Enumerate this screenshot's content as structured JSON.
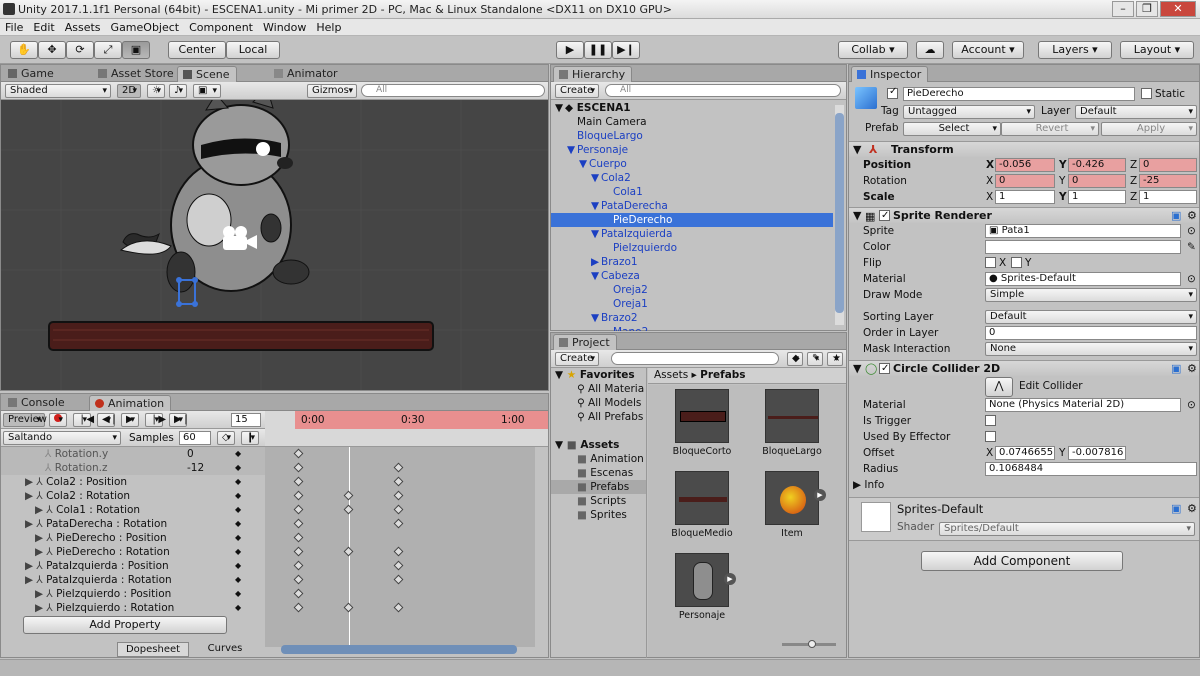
{
  "window": {
    "title": "Unity 2017.1.1f1 Personal (64bit) - ESCENA1.unity - Mi primer 2D - PC, Mac & Linux Standalone <DX11 on DX10 GPU>"
  },
  "menu": [
    "File",
    "Edit",
    "Assets",
    "GameObject",
    "Component",
    "Window",
    "Help"
  ],
  "toolbar": {
    "center": "Center",
    "local": "Local",
    "collab": "Collab",
    "account": "Account",
    "layers": "Layers",
    "layout": "Layout"
  },
  "scene_tabs": {
    "game": "Game",
    "asset_store": "Asset Store",
    "scene": "Scene",
    "animator": "Animator"
  },
  "scene_strip": {
    "shaded": "Shaded",
    "mode2d": "2D",
    "gizmos": "Gizmos",
    "search": "All"
  },
  "hierarchy": {
    "tab": "Hierarchy",
    "create": "Create",
    "search": "All",
    "items": [
      {
        "label": "ESCENA1",
        "indent": 0,
        "arrow": "▼",
        "root": true,
        "sel": false
      },
      {
        "label": "Main Camera",
        "indent": 1,
        "arrow": "",
        "root": false,
        "sel": false,
        "plain": true
      },
      {
        "label": "BloqueLargo",
        "indent": 1,
        "arrow": "",
        "root": false,
        "sel": false
      },
      {
        "label": "Personaje",
        "indent": 1,
        "arrow": "▼",
        "root": false,
        "sel": false
      },
      {
        "label": "Cuerpo",
        "indent": 2,
        "arrow": "▼",
        "root": false,
        "sel": false
      },
      {
        "label": "Cola2",
        "indent": 3,
        "arrow": "▼",
        "root": false,
        "sel": false
      },
      {
        "label": "Cola1",
        "indent": 4,
        "arrow": "",
        "root": false,
        "sel": false
      },
      {
        "label": "PataDerecha",
        "indent": 3,
        "arrow": "▼",
        "root": false,
        "sel": false
      },
      {
        "label": "PieDerecho",
        "indent": 4,
        "arrow": "",
        "root": false,
        "sel": true
      },
      {
        "label": "PataIzquierda",
        "indent": 3,
        "arrow": "▼",
        "root": false,
        "sel": false
      },
      {
        "label": "PieIzquierdo",
        "indent": 4,
        "arrow": "",
        "root": false,
        "sel": false
      },
      {
        "label": "Brazo1",
        "indent": 3,
        "arrow": "▶",
        "root": false,
        "sel": false
      },
      {
        "label": "Cabeza",
        "indent": 3,
        "arrow": "▼",
        "root": false,
        "sel": false
      },
      {
        "label": "Oreja2",
        "indent": 4,
        "arrow": "",
        "root": false,
        "sel": false
      },
      {
        "label": "Oreja1",
        "indent": 4,
        "arrow": "",
        "root": false,
        "sel": false
      },
      {
        "label": "Brazo2",
        "indent": 3,
        "arrow": "▼",
        "root": false,
        "sel": false
      },
      {
        "label": "Mano2",
        "indent": 4,
        "arrow": "",
        "root": false,
        "sel": false
      }
    ]
  },
  "project": {
    "tab": "Project",
    "create": "Create",
    "favorites": "Favorites",
    "fav_items": [
      "All Materia",
      "All Models",
      "All Prefabs"
    ],
    "assets": "Assets",
    "folders": [
      "Animation",
      "Escenas",
      "Prefabs",
      "Scripts",
      "Sprites"
    ],
    "breadcrumb": [
      "Assets",
      "Prefabs"
    ],
    "prefabs": [
      "BloqueCorto",
      "BloqueLargo",
      "BloqueMedio",
      "Item",
      "Personaje"
    ]
  },
  "inspector": {
    "tab": "Inspector",
    "name": "PieDerecho",
    "static": "Static",
    "tag_label": "Tag",
    "tag": "Untagged",
    "layer_label": "Layer",
    "layer": "Default",
    "prefab_label": "Prefab",
    "select": "Select",
    "revert": "Revert",
    "apply": "Apply",
    "transform": {
      "title": "Transform",
      "position": "Position",
      "rotation": "Rotation",
      "scale": "Scale",
      "pos": [
        "-0.056",
        "-0.426",
        "0"
      ],
      "rot": [
        "0",
        "0",
        "-25"
      ],
      "scl": [
        "1",
        "1",
        "1"
      ]
    },
    "sprite_renderer": {
      "title": "Sprite Renderer",
      "sprite_label": "Sprite",
      "sprite": "Pata1",
      "color_label": "Color",
      "flip_label": "Flip",
      "material_label": "Material",
      "material": "Sprites-Default",
      "draw_label": "Draw Mode",
      "draw": "Simple",
      "sorting_label": "Sorting Layer",
      "sorting": "Default",
      "order_label": "Order in Layer",
      "order": "0",
      "mask_label": "Mask Interaction",
      "mask": "None"
    },
    "collider": {
      "title": "Circle Collider 2D",
      "edit": "Edit Collider",
      "material_label": "Material",
      "material": "None (Physics Material 2D)",
      "trigger_label": "Is Trigger",
      "effector_label": "Used By Effector",
      "offset_label": "Offset",
      "offset": [
        "0.0746655",
        "-0.007816"
      ],
      "radius_label": "Radius",
      "radius": "0.1068484",
      "info": "Info"
    },
    "mat": {
      "name": "Sprites-Default",
      "shader_label": "Shader",
      "shader": "Sprites/Default"
    },
    "add_component": "Add Component"
  },
  "animation": {
    "console_tab": "Console",
    "anim_tab": "Animation",
    "preview": "Preview",
    "frame": "15",
    "clip": "Saltando",
    "samples_label": "Samples",
    "samples": "60",
    "times": [
      "0:00",
      "0:30",
      "1:00"
    ],
    "props": [
      {
        "label": "Rotation.y",
        "value": "0",
        "indent": 2,
        "muted": true,
        "key": [
          0
        ]
      },
      {
        "label": "Rotation.z",
        "value": "-12",
        "indent": 2,
        "muted": true,
        "key": [
          0,
          2
        ]
      },
      {
        "label": "Cola2 : Position",
        "value": "",
        "indent": 0,
        "key": [
          0,
          2
        ]
      },
      {
        "label": "Cola2 : Rotation",
        "value": "",
        "indent": 0,
        "key": [
          0,
          1,
          2
        ]
      },
      {
        "label": "Cola1 : Rotation",
        "value": "",
        "indent": 1,
        "key": [
          0,
          1,
          2
        ]
      },
      {
        "label": "PataDerecha : Rotation",
        "value": "",
        "indent": 0,
        "key": [
          0,
          2
        ]
      },
      {
        "label": "PieDerecho : Position",
        "value": "",
        "indent": 1,
        "key": [
          0
        ]
      },
      {
        "label": "PieDerecho : Rotation",
        "value": "",
        "indent": 1,
        "key": [
          0,
          1,
          2
        ]
      },
      {
        "label": "PataIzquierda : Position",
        "value": "",
        "indent": 0,
        "key": [
          0,
          2
        ]
      },
      {
        "label": "PataIzquierda : Rotation",
        "value": "",
        "indent": 0,
        "key": [
          0,
          2
        ]
      },
      {
        "label": "PieIzquierdo : Position",
        "value": "",
        "indent": 1,
        "key": [
          0
        ]
      },
      {
        "label": "PieIzquierdo : Rotation",
        "value": "",
        "indent": 1,
        "key": [
          0,
          1,
          2
        ]
      }
    ],
    "add_property": "Add Property",
    "dopesheet": "Dopesheet",
    "curves": "Curves"
  },
  "colors": {
    "selection": "#3a72d8",
    "red_field": "#e8a0a0",
    "scene_bg": "#454545"
  }
}
